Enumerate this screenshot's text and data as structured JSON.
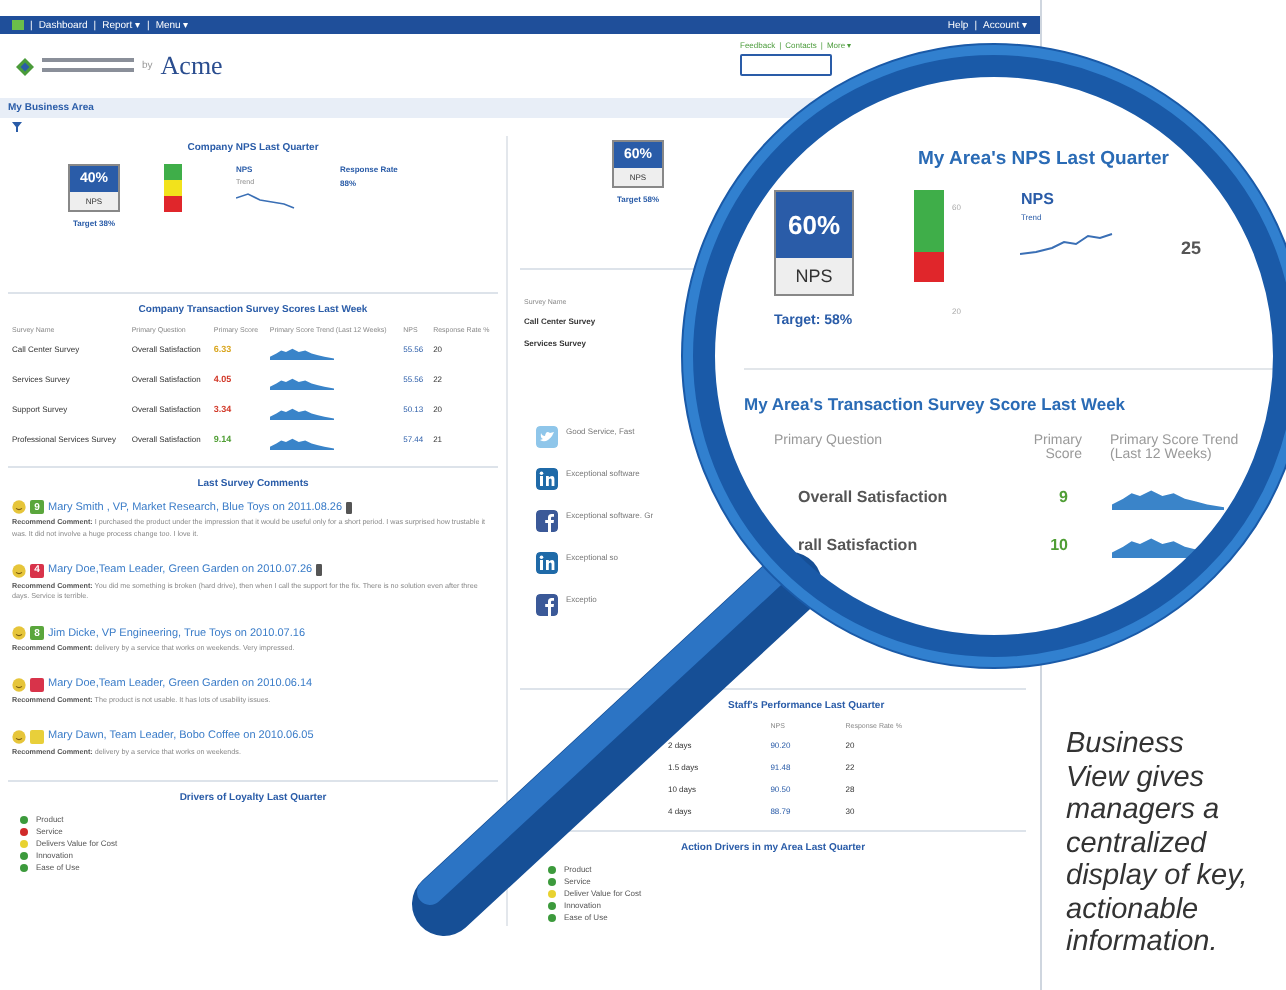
{
  "top_bar": {
    "separator": "|",
    "menu": [
      "Dashboard",
      "Report ▾",
      "Menu ▾"
    ],
    "account_menu": [
      "Help",
      "Account ▾"
    ]
  },
  "header": {
    "logo_by": "by",
    "logo_brand": "Acme",
    "links": [
      "Feedback",
      "Contacts",
      "More ▾"
    ]
  },
  "page_title": "My Business Area",
  "company_nps": {
    "title": "Company NPS Last Quarter",
    "value": "40%",
    "label": "NPS",
    "target": "Target 38%",
    "trend_title": "NPS",
    "trend_subtitle": "Trend",
    "response_title": "Response Rate",
    "response_value": "88%"
  },
  "company_table": {
    "title": "Company Transaction Survey Scores Last Week",
    "columns": [
      "Survey Name",
      "Primary Question",
      "Primary Score",
      "Primary Score Trend (Last 12 Weeks)",
      "NPS",
      "Response Rate %"
    ],
    "rows": [
      {
        "survey": "Call Center Survey",
        "question": "Overall Satisfaction",
        "score": "6.33",
        "color": "#d9a51c",
        "nps": "55.56",
        "rate": "20"
      },
      {
        "survey": "Services Survey",
        "question": "Overall Satisfaction",
        "score": "4.05",
        "color": "#d23a2a",
        "nps": "55.56",
        "rate": "22"
      },
      {
        "survey": "Support Survey",
        "question": "Overall Satisfaction",
        "score": "3.34",
        "color": "#d23a2a",
        "nps": "50.13",
        "rate": "20"
      },
      {
        "survey": "Professional Services Survey",
        "question": "Overall Satisfaction",
        "score": "9.14",
        "color": "#4f9e34",
        "nps": "57.44",
        "rate": "21"
      }
    ]
  },
  "comments": {
    "title": "Last Survey Comments",
    "items": [
      {
        "badge": "9",
        "color": "#5aa63c",
        "author": "Mary Smith , VP, Market Research, Blue Toys on 2011.08.26",
        "attachment": true,
        "label": "Recommend Comment:",
        "text": "I purchased the product under the impression that it would be useful only for a short period. I was surprised how trustable it was. It did not involve a huge process change too. I love it."
      },
      {
        "badge": "4",
        "color": "#d8334a",
        "author": "Mary Doe,Team Leader, Green Garden on 2010.07.26",
        "attachment": true,
        "label": "Recommend Comment:",
        "text": "You did me something is broken (hard drive), then when I call the support for the fix. There is no solution even after three days. Service is terrible."
      },
      {
        "badge": "8",
        "color": "#5aa63c",
        "author": "Jim Dicke, VP Engineering, True Toys on 2010.07.16",
        "attachment": false,
        "label": "Recommend Comment:",
        "text": "delivery by a service that works on weekends. Very impressed."
      },
      {
        "color": "#d8334a",
        "author": "Mary Doe,Team Leader, Green Garden on 2010.06.14",
        "attachment": false,
        "label": "Recommend Comment:",
        "text": "The product is not usable. It has lots of usability issues."
      },
      {
        "color": "#e8cf3a",
        "author": "Mary Dawn, Team Leader, Bobo Coffee on 2010.06.05",
        "attachment": false,
        "label": "Recommend Comment:",
        "text": "delivery by a service that works on weekends."
      }
    ]
  },
  "loyalty_drivers": {
    "title": "Drivers of Loyalty Last Quarter",
    "items": [
      {
        "label": "Product",
        "color": "#3c9a3c"
      },
      {
        "label": "Service",
        "color": "#d02a2a"
      },
      {
        "label": "Delivers Value for Cost",
        "color": "#e8d230"
      },
      {
        "label": "Innovation",
        "color": "#3c9a3c"
      },
      {
        "label": "Ease of Use",
        "color": "#3c9a3c"
      }
    ]
  },
  "area_nps": {
    "value": "60%",
    "label": "NPS",
    "target": "Target 58%"
  },
  "area_table": {
    "columns": [
      "Survey Name"
    ],
    "rows": [
      "Call Center Survey",
      "Services Survey"
    ]
  },
  "social": {
    "items": [
      {
        "kind": "twitter",
        "text": "Good Service, Fast"
      },
      {
        "kind": "linkedin",
        "text": "Exceptional software"
      },
      {
        "kind": "facebook",
        "text": "Exceptional software. Gr"
      },
      {
        "kind": "linkedin",
        "text": "Exceptional so"
      },
      {
        "kind": "facebook",
        "text": "Exceptio"
      }
    ]
  },
  "staff_performance": {
    "title": "Staff's Performance Last Quarter",
    "column_headers": {
      "nps": "NPS",
      "response_rate": "Response Rate %"
    },
    "rows": [
      {
        "period": "2 days",
        "nps": "90.20",
        "rate": "20"
      },
      {
        "period": "1.5 days",
        "nps": "91.48",
        "rate": "22"
      },
      {
        "period": "10 days",
        "nps": "90.50",
        "rate": "28"
      },
      {
        "period": "4 days",
        "nps": "88.79",
        "rate": "30"
      }
    ]
  },
  "action_drivers": {
    "title": "Action Drivers in my Area Last Quarter",
    "items": [
      {
        "label": "Product",
        "color": "#3c9a3c"
      },
      {
        "label": "Service",
        "color": "#3c9a3c"
      },
      {
        "label": "Deliver Value for Cost",
        "color": "#e8d230"
      },
      {
        "label": "Innovation",
        "color": "#3c9a3c"
      },
      {
        "label": "Ease of Use",
        "color": "#3c9a3c"
      }
    ]
  },
  "lens": {
    "nps_title": "My Area's NPS Last Quarter",
    "value": "60%",
    "label": "NPS",
    "target": "Target: 58%",
    "scale": [
      "60",
      "20"
    ],
    "trend_title": "NPS",
    "trend_subtitle": "Trend",
    "partial_value": "25",
    "table_title": "My Area's Transaction Survey Score Last Week",
    "columns": [
      "Primary Question",
      "Primary Score",
      "Primary Score Trend (Last 12 Weeks)"
    ],
    "rows": [
      {
        "question": "Overall Satisfaction",
        "score": "9"
      },
      {
        "question": "rall Satisfaction",
        "score": "10"
      }
    ]
  },
  "caption": "Business View gives managers a centralized display of key, actionable information."
}
